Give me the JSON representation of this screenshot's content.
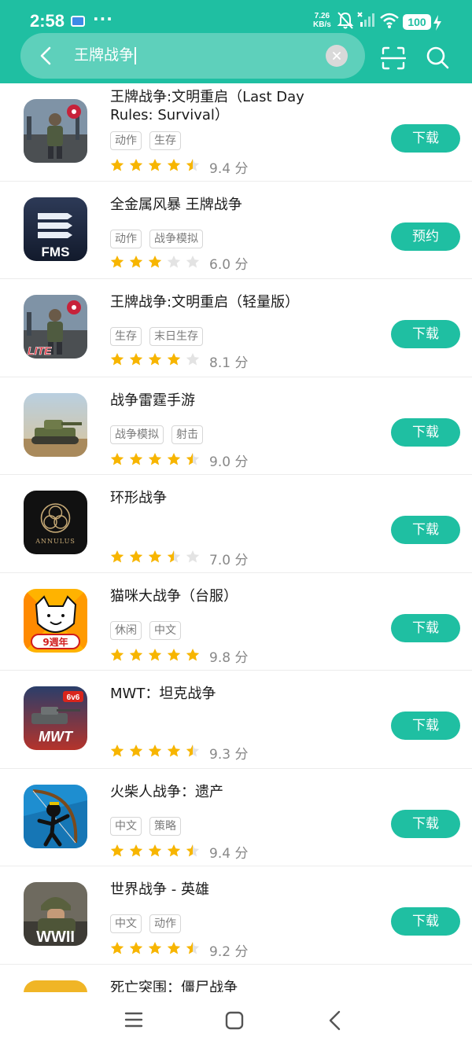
{
  "status_bar": {
    "time": "2:58",
    "more": "···",
    "net_speed_value": "7.26",
    "net_speed_unit": "KB/s",
    "battery": "100"
  },
  "search": {
    "query": "王牌战争"
  },
  "colors": {
    "brand": "#1fbfa2",
    "star_filled": "#f7b500",
    "star_empty": "#e3e3e3"
  },
  "apps": [
    {
      "title": "王牌战争:文明重启（Last Day Rules: Survival）",
      "tags": [
        "动作",
        "生存"
      ],
      "rating": 4.5,
      "score": "9.4 分",
      "button": "下载",
      "icon": "zombie-soldier-icon"
    },
    {
      "title": "全金属风暴 王牌战争",
      "tags": [
        "动作",
        "战争模拟"
      ],
      "rating": 3,
      "score": "6.0 分",
      "button": "预约",
      "icon": "fms-logo-icon"
    },
    {
      "title": "王牌战争:文明重启（轻量版）",
      "tags": [
        "生存",
        "末日生存"
      ],
      "rating": 4,
      "score": "8.1 分",
      "button": "下载",
      "icon": "zombie-soldier-lite-icon"
    },
    {
      "title": "战争雷霆手游",
      "tags": [
        "战争模拟",
        "射击"
      ],
      "rating": 4.5,
      "score": "9.0 分",
      "button": "下载",
      "icon": "tank-icon"
    },
    {
      "title": "环形战争",
      "tags": [],
      "rating": 3.5,
      "score": "7.0 分",
      "button": "下载",
      "icon": "annulus-logo-icon"
    },
    {
      "title": "猫咪大战争（台服）",
      "tags": [
        "休闲",
        "中文"
      ],
      "rating": 5,
      "score": "9.8 分",
      "button": "下载",
      "icon": "cat-icon"
    },
    {
      "title": "MWT：坦克战争",
      "tags": [],
      "rating": 4.5,
      "score": "9.3 分",
      "button": "下载",
      "icon": "mwt-tank-icon"
    },
    {
      "title": "火柴人战争：遗产",
      "tags": [
        "中文",
        "策略"
      ],
      "rating": 4.5,
      "score": "9.4 分",
      "button": "下载",
      "icon": "stickman-archer-icon"
    },
    {
      "title": "世界战争 - 英雄",
      "tags": [
        "中文",
        "动作"
      ],
      "rating": 4.5,
      "score": "9.2 分",
      "button": "下载",
      "icon": "wwii-soldier-icon"
    },
    {
      "title": "死亡突围：僵尸战争",
      "tags": [],
      "rating": 0,
      "score": "",
      "button": "",
      "icon": "zombie-game-icon"
    }
  ],
  "icon_text": {
    "fms": "FMS",
    "lite": "LITE",
    "annulus": "ANNULUS",
    "cat_badge": "9週年",
    "mwt_badge": "6v6",
    "mwt": "MWT",
    "wwii": "WWII"
  }
}
